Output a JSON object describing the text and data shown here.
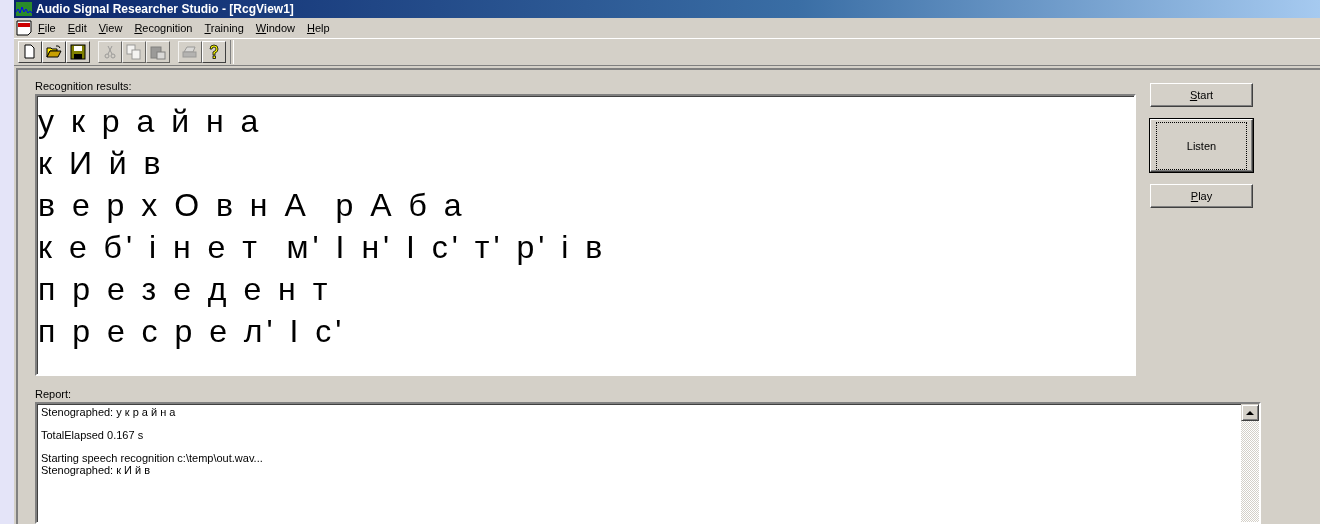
{
  "window": {
    "title": "Audio Signal Researcher Studio - [RcgView1]"
  },
  "menu": [
    {
      "label": "File"
    },
    {
      "label": "Edit"
    },
    {
      "label": "View"
    },
    {
      "label": "Recognition"
    },
    {
      "label": "Training"
    },
    {
      "label": "Window"
    },
    {
      "label": "Help"
    }
  ],
  "toolbar": [
    {
      "kind": "new",
      "disabled": false
    },
    {
      "kind": "open",
      "disabled": false
    },
    {
      "kind": "save",
      "disabled": false
    },
    {
      "kind": "sep"
    },
    {
      "kind": "cut",
      "disabled": true
    },
    {
      "kind": "copy",
      "disabled": true
    },
    {
      "kind": "paste",
      "disabled": true
    },
    {
      "kind": "sep"
    },
    {
      "kind": "print",
      "disabled": true
    },
    {
      "kind": "help",
      "disabled": false
    }
  ],
  "recognition": {
    "label": "Recognition results:",
    "lines": [
      "у к р а й н а",
      "к И й в",
      "в е р х О в н А  р А б а",
      "к е б' і н е т  м' І н' І с' т' р' і в",
      "п р е з е д е н т",
      "п р е с р е л' І с'"
    ]
  },
  "buttons": [
    {
      "label": "Start",
      "mnemonic": true,
      "default": false
    },
    {
      "label": "Listen",
      "mnemonic": false,
      "default": true
    },
    {
      "label": "Play",
      "mnemonic": true,
      "default": false
    }
  ],
  "report": {
    "label": "Report:",
    "paragraphs": [
      [
        "Stenographed: у к р а й н а"
      ],
      [
        "TotalElapsed 0.167 s"
      ],
      [
        "Starting speech recognition c:\\temp\\out.wav...",
        "Stenographed: к И й в"
      ]
    ]
  }
}
